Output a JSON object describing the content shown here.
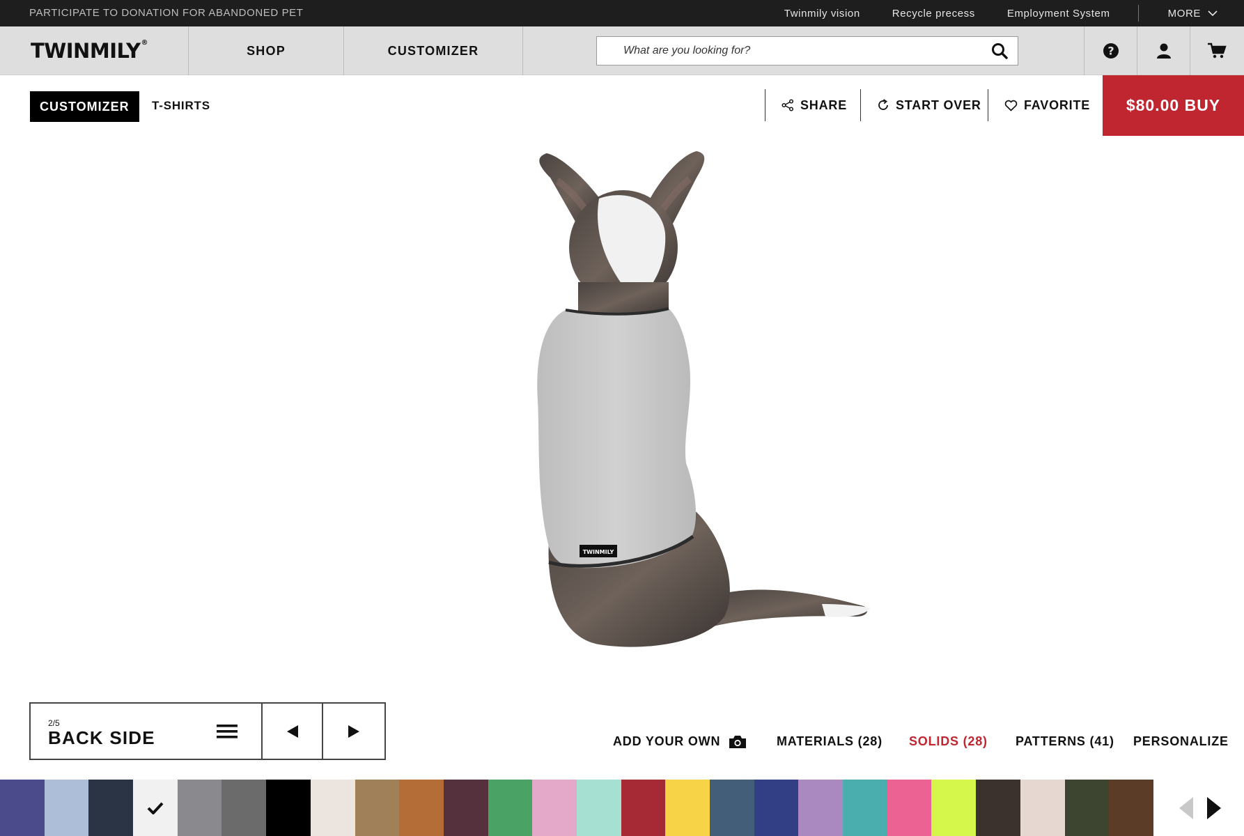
{
  "topbar": {
    "promo": "PARTICIPATE TO DONATION FOR ABANDONED PET",
    "links": [
      "Twinmily vision",
      "Recycle precess",
      "Employment System"
    ],
    "more": "MORE"
  },
  "nav": {
    "logo": "TWINMILY",
    "logo_mark": "®",
    "shop": "SHOP",
    "customizer": "CUSTOMIZER",
    "search_placeholder": "What are you looking for?",
    "icons": [
      "help-icon",
      "user-icon",
      "cart-icon"
    ]
  },
  "toolbar": {
    "crumb_active": "CUSTOMIZER",
    "crumb": "T-SHIRTS",
    "share": "SHARE",
    "start_over": "START OVER",
    "favorite": "FAVORITE",
    "buy": "$80.00 BUY"
  },
  "product": {
    "tag_text": "TWINMILY",
    "shirt_color": "#c9c9c9"
  },
  "side_selector": {
    "count": "2/5",
    "title": "BACK SIDE"
  },
  "options": {
    "add_your_own": "ADD YOUR OWN",
    "materials": "MATERIALS (28)",
    "solids": "SOLIDS (28)",
    "patterns": "PATTERNS (41)",
    "personalize": "PERSONALIZE",
    "active": "solids"
  },
  "colors": {
    "accent": "#c0262f",
    "topbar": "#1e1e1e",
    "nav": "#dedede"
  },
  "swatches": {
    "selected_index": 3,
    "items": [
      "#4b4a8a",
      "#adbfd8",
      "#2a3444",
      "#f1f1f1",
      "#8a8a8e",
      "#6b6b6b",
      "#000000",
      "#ece4de",
      "#a08058",
      "#b56d37",
      "#54313d",
      "#4aa265",
      "#e4a8c8",
      "#a6e0d2",
      "#a62a36",
      "#f7d447",
      "#425e78",
      "#323f85",
      "#a989bf",
      "#4aaeae",
      "#ec6293",
      "#d5f64b",
      "#3b322d",
      "#e6d7d0",
      "#3d4430",
      "#5b3c26"
    ]
  }
}
